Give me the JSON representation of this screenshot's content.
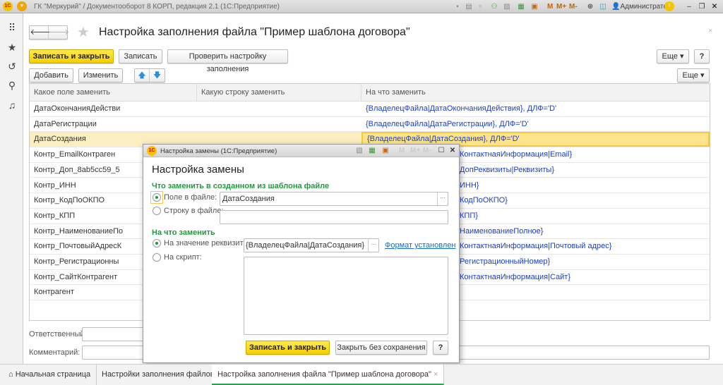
{
  "app": {
    "title": "ГК \"Меркурий\" / Документооборот 8 КОРП, редакция 2.1  (1С:Предприятие)",
    "logo": "1С",
    "user": "Администратор",
    "memory": [
      "M",
      "M+",
      "M-"
    ]
  },
  "icons": {
    "sidebar": [
      "apps-grid-icon",
      "star-icon",
      "history-icon",
      "search-icon",
      "bell-icon"
    ]
  },
  "form": {
    "title": "Настройка заполнения файла \"Пример шаблона договора\"",
    "toolbar": {
      "save_close": "Записать и закрыть",
      "save": "Записать",
      "check": "Проверить настройку заполнения",
      "more": "Еще ▾",
      "help": "?"
    },
    "table_toolbar": {
      "add": "Добавить",
      "edit": "Изменить",
      "more": "Еще ▾"
    },
    "table": {
      "columns": [
        "Какое поле заменить",
        "Какую строку заменить",
        "На что заменить"
      ],
      "rows": [
        {
          "field": "ДатаОкончанияДействи",
          "value": "{ВладелецФайла|ДатаОкончанияДействия}, ДЛФ='D'"
        },
        {
          "field": "ДатаРегистрации",
          "value": "{ВладелецФайла|ДатаРегистрации}, ДЛФ='D'"
        },
        {
          "field": "ДатаСоздания",
          "value": "{ВладелецФайла|ДатаСоздания}, ДЛФ='D'",
          "selected": true
        },
        {
          "field": "Контр_EmailКонтраген",
          "value": "КонтактнаяИнформация|Email}",
          "partial": true
        },
        {
          "field": "Контр_Доп_8ab5cc59_5",
          "value": "ДопРеквизиты|Реквизиты}",
          "partial": true
        },
        {
          "field": "Контр_ИНН",
          "value": "ИНН}",
          "partial": true
        },
        {
          "field": "Контр_КодПоОКПО",
          "value": "КодПоОКПО}",
          "partial": true
        },
        {
          "field": "Контр_КПП",
          "value": "КПП}",
          "partial": true
        },
        {
          "field": "Контр_НаименованиеПо",
          "value": "НаименованиеПолное}",
          "partial": true
        },
        {
          "field": "Контр_ПочтовыйАдресК",
          "value": "КонтактнаяИнформация|Почтовый адрес}",
          "partial": true
        },
        {
          "field": "Контр_Регистрационны",
          "value": "РегистрационныйНомер}",
          "partial": true
        },
        {
          "field": "Контр_СайтКонтрагент",
          "value": "КонтактнаяИнформация|Сайт}",
          "partial": true
        },
        {
          "field": "Контрагент",
          "value": ""
        }
      ]
    },
    "responsible_label": "Ответственный:",
    "comment_label": "Комментарий:"
  },
  "dialog": {
    "window_title": "Настройка замены  (1С:Предприятие)",
    "heading": "Настройка замены",
    "section1": "Что заменить в созданном из шаблона файле",
    "radio_field": "Поле в файле:",
    "field_value": "ДатаСоздания",
    "radio_string": "Строку в файле:",
    "string_value": "",
    "section2": "На что заменить",
    "radio_attr": "На значение реквизита:",
    "attr_value": "{ВладелецФайла|ДатаСоздания}",
    "format_link": "Формат установлен",
    "radio_script": "На скрипт:",
    "selected_what": "field",
    "selected_with": "attribute",
    "save_close": "Записать и закрыть",
    "close_nosave": "Закрыть без сохранения",
    "help": "?"
  },
  "tabs": [
    {
      "label": "Начальная страница"
    },
    {
      "label": "Настройки заполнения файлов"
    },
    {
      "label": "Настройка заполнения файла \"Пример шаблона договора\"",
      "active": true
    }
  ],
  "colors": {
    "accent": "#f4cf00",
    "link": "#1b3fc4",
    "green": "#1e9a3c",
    "selected_row": "#fbeec0"
  }
}
